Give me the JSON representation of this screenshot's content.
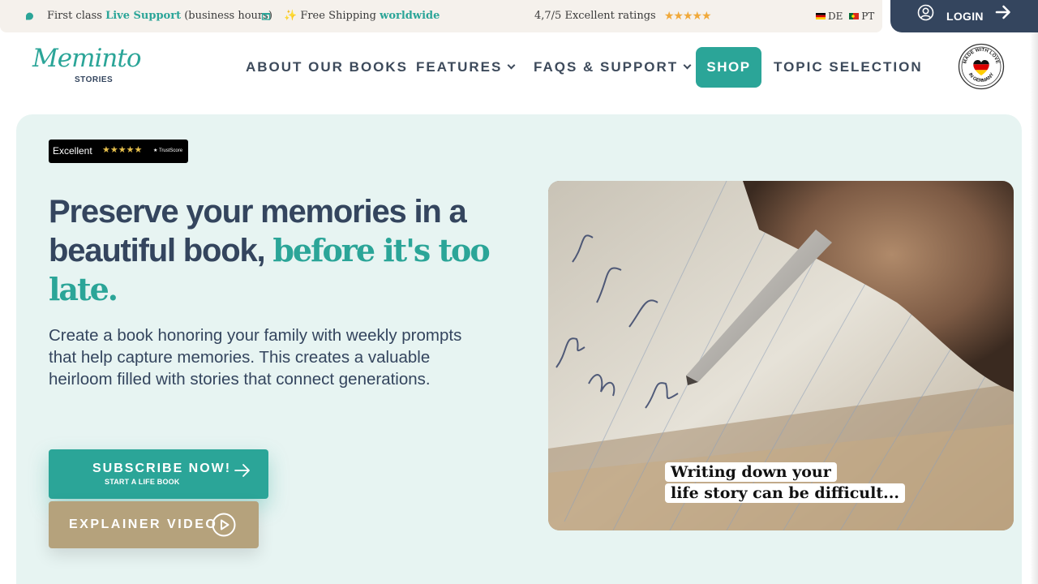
{
  "topbar": {
    "support_prefix": "First class",
    "support_highlight": "Live Support",
    "support_suffix": "(business hours)",
    "shipping_prefix": "✨ Free Shipping",
    "shipping_highlight": "worldwide",
    "ratings_text": "4,7/5 Excellent ratings",
    "ratings_stars": "★★★★★",
    "lang_de": "DE",
    "lang_pt": "PT",
    "login_label": "LOGIN",
    "icons": [
      "chat-icon",
      "gift-icon",
      "user-circle-icon",
      "arrow-right-icon"
    ]
  },
  "header": {
    "logo_script": "Meminto",
    "logo_sub": "STORIES",
    "nav": {
      "about": "ABOUT OUR BOOKS",
      "features": "FEATURES",
      "faqs": "FAQS & SUPPORT",
      "shop": "SHOP",
      "topics": "TOPIC SELECTION"
    },
    "badge": {
      "top_text": "MADE WITH LOVE",
      "bottom_text": "IN GERMANY"
    }
  },
  "hero": {
    "trust": {
      "label": "Excellent",
      "stars": "★★★★★",
      "brand": "★ TrustScore"
    },
    "headline_plain": "Preserve your memories in a beautiful book,",
    "headline_highlight": "before it's too late.",
    "lead": "Create a book honoring your family with weekly prompts that help capture memories. This creates a valuable heirloom filled with stories that connect generations.",
    "subscribe_label": "SUBSCRIBE NOW!",
    "subscribe_sub": "START A LIFE BOOK",
    "video_label": "EXPLAINER VIDEO",
    "video_caption_line1": "Writing down your",
    "video_caption_line2": "life story can be difficult..."
  },
  "colors": {
    "accent": "#2ba598",
    "navy": "#34455e",
    "hero_bg": "#e7f4f2",
    "topbar_bg": "#f5f1ec",
    "video_button": "#b5a27c"
  }
}
